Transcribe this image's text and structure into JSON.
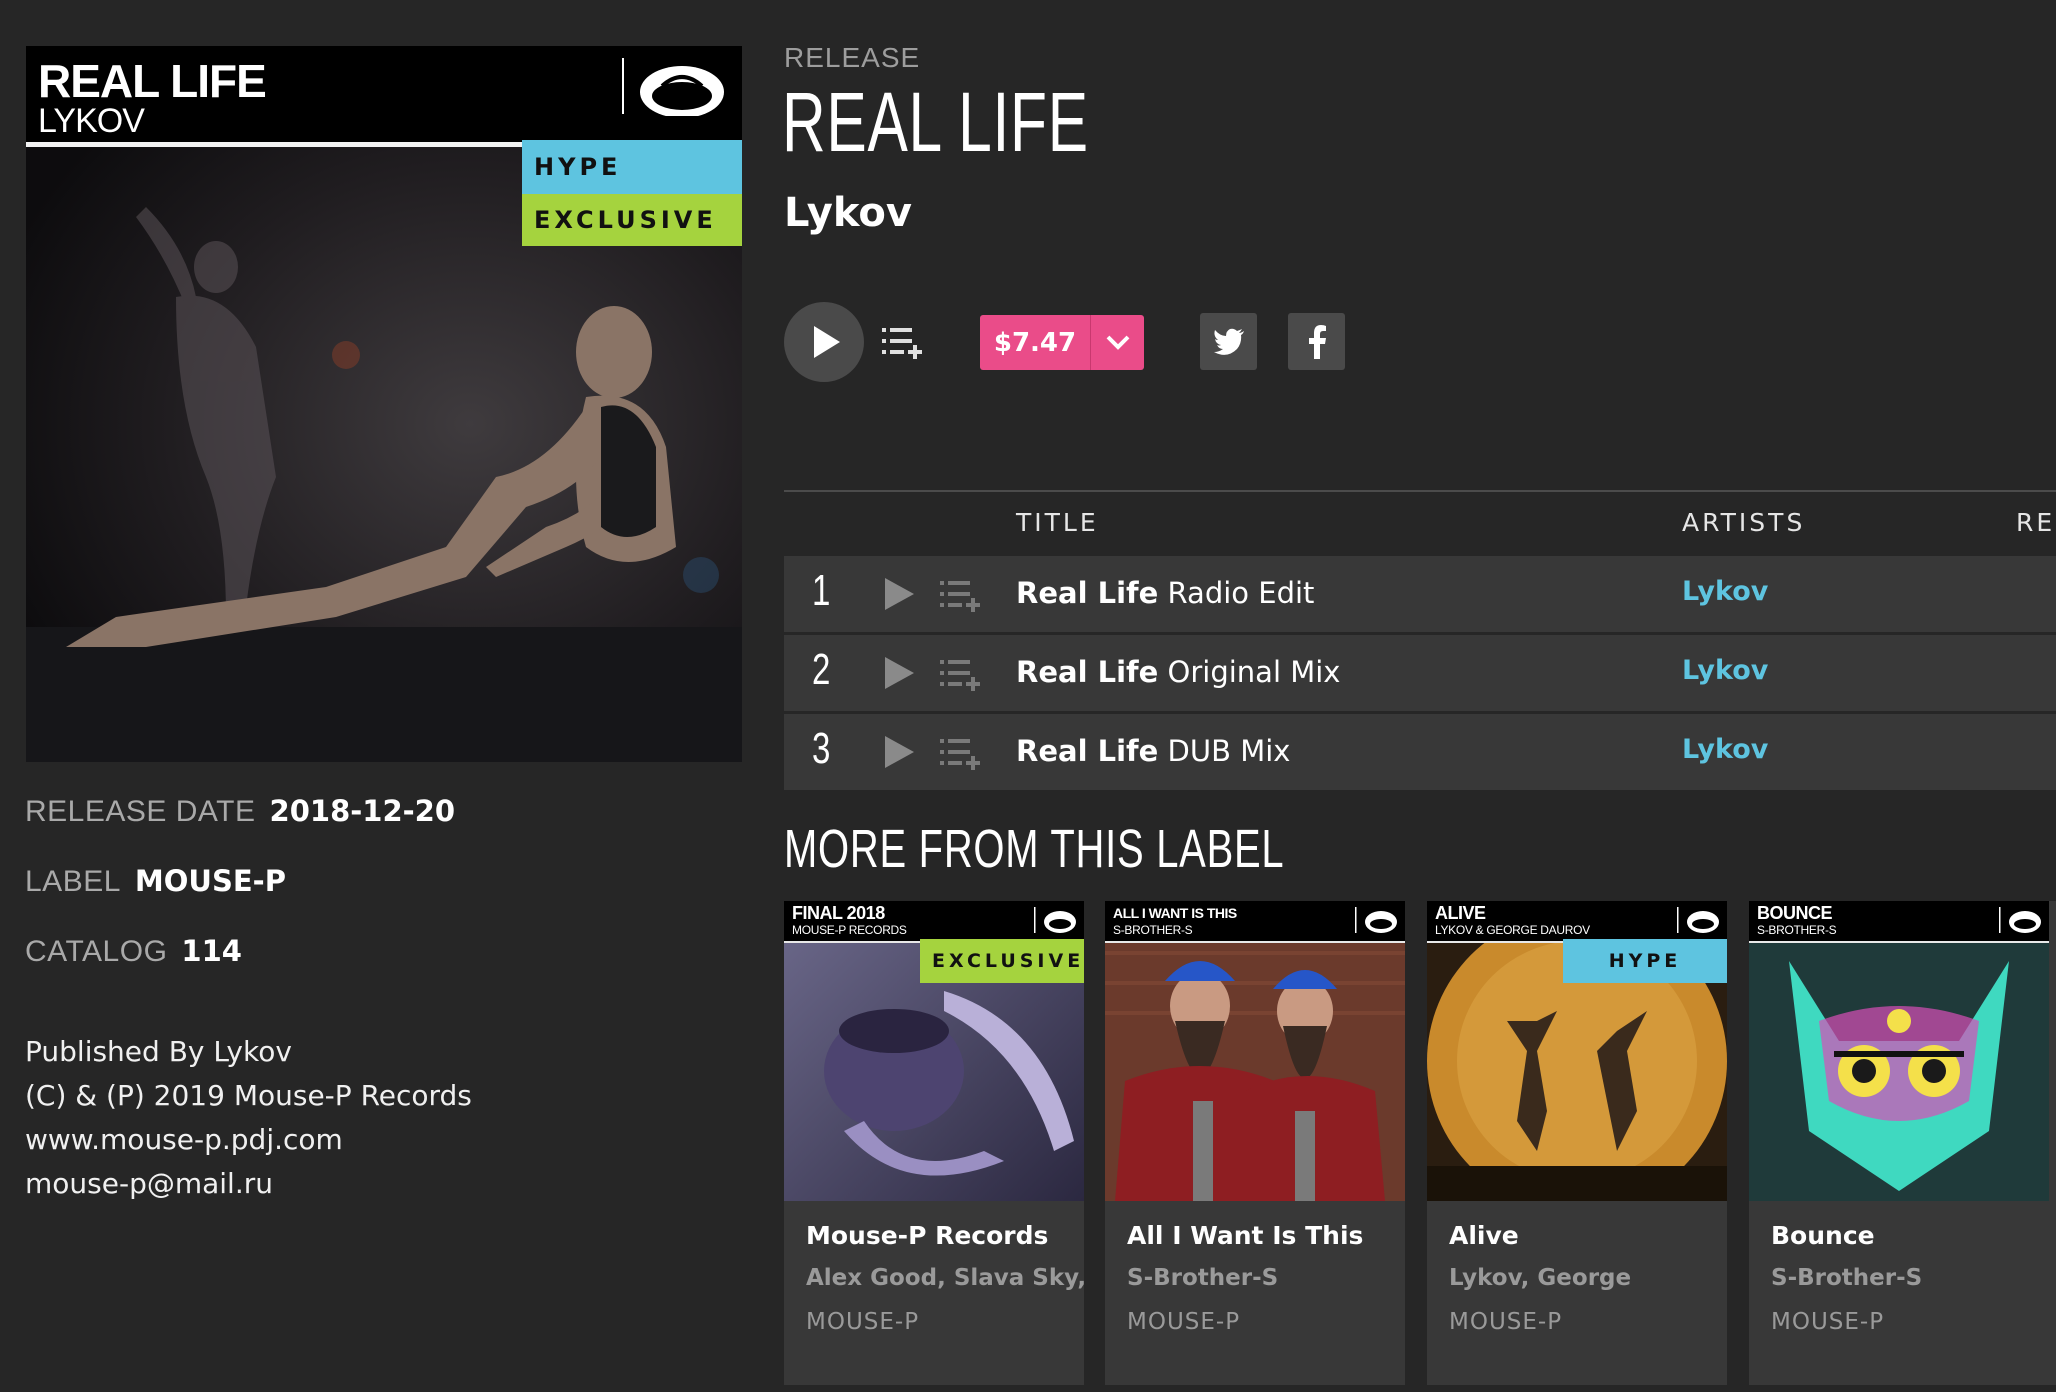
{
  "cover": {
    "title": "REAL LIFE",
    "artist": "LYKOV",
    "badges": [
      "HYPE",
      "EXCLUSIVE"
    ],
    "colors": {
      "hype": "#5ec4e0",
      "exclusive": "#a5d33e"
    }
  },
  "release": {
    "section_label": "RELEASE",
    "title": "REAL LIFE",
    "artist": "Lykov",
    "price": "$7.47",
    "price_color": "#ea4c89"
  },
  "meta": {
    "release_date_label": "RELEASE DATE",
    "release_date": "2018-12-20",
    "label_label": "LABEL",
    "label": "MOUSE-P",
    "catalog_label": "CATALOG",
    "catalog": "114"
  },
  "publishing": [
    "Published By Lykov",
    "(C) & (P) 2019 Mouse-P Records",
    "www.mouse-p.pdj.com",
    "mouse-p@mail.ru"
  ],
  "tracks_table": {
    "headers": {
      "title": "TITLE",
      "artists": "ARTISTS",
      "remixers": "REM"
    },
    "rows": [
      {
        "num": "1",
        "name": "Real Life",
        "mix": "Radio Edit",
        "artist": "Lykov"
      },
      {
        "num": "2",
        "name": "Real Life",
        "mix": "Original Mix",
        "artist": "Lykov"
      },
      {
        "num": "3",
        "name": "Real Life",
        "mix": "DUB Mix",
        "artist": "Lykov"
      }
    ]
  },
  "more": {
    "title": "MORE FROM THIS LABEL",
    "cards": [
      {
        "art_title": "FINAL 2018",
        "art_sub": "MOUSE-P RECORDS",
        "badge": "EXCLUSIVE",
        "name": "Mouse-P Records",
        "artists": "Alex Good, Slava Sky,",
        "label": "MOUSE-P"
      },
      {
        "art_title": "ALL I WANT IS THIS",
        "art_sub": "S-BROTHER-S",
        "badge": "",
        "name": "All I Want Is This",
        "artists": "S-Brother-S",
        "label": "MOUSE-P"
      },
      {
        "art_title": "ALIVE",
        "art_sub": "LYKOV & GEORGE DAUROV",
        "badge": "HYPE",
        "name": "Alive",
        "artists": "Lykov, George",
        "label": "MOUSE-P"
      },
      {
        "art_title": "BOUNCE",
        "art_sub": "S-BROTHER-S",
        "badge": "",
        "name": "Bounce",
        "artists": "S-Brother-S",
        "label": "MOUSE-P"
      }
    ]
  }
}
